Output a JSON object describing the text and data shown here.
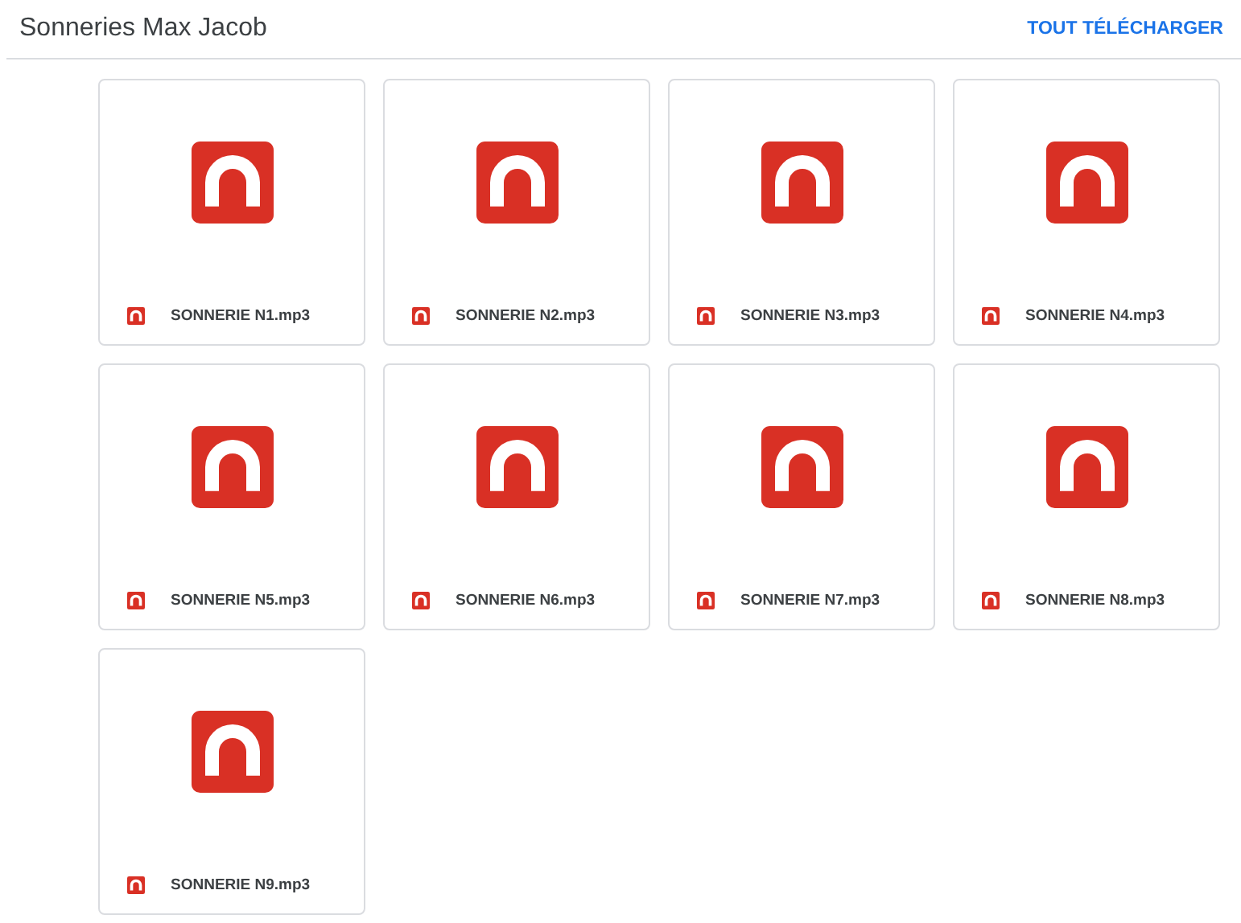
{
  "header": {
    "title": "Sonneries Max Jacob",
    "action": "TOUT TÉLÉCHARGER"
  },
  "files": [
    {
      "name": "SONNERIE N1.mp3"
    },
    {
      "name": "SONNERIE N2.mp3"
    },
    {
      "name": "SONNERIE N3.mp3"
    },
    {
      "name": "SONNERIE N4.mp3"
    },
    {
      "name": "SONNERIE N5.mp3"
    },
    {
      "name": "SONNERIE N6.mp3"
    },
    {
      "name": "SONNERIE N7.mp3"
    },
    {
      "name": "SONNERIE N8.mp3"
    },
    {
      "name": "SONNERIE N9.mp3"
    }
  ]
}
